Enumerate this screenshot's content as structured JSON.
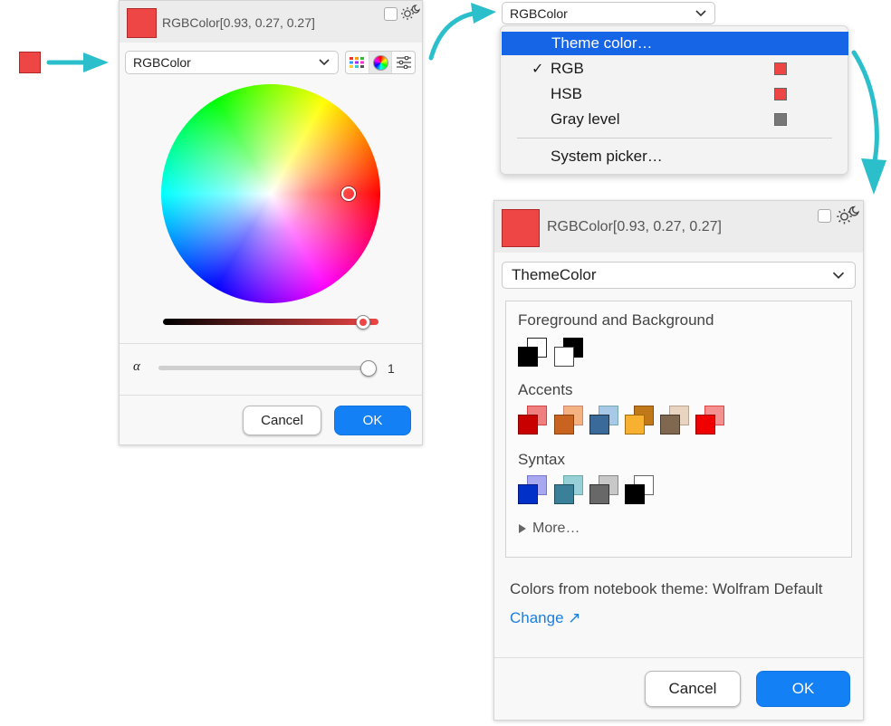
{
  "panel1": {
    "header_text": "RGBColor[0.93, 0.27, 0.27]",
    "dropdown_value": "RGBColor",
    "alpha_label": "α",
    "alpha_value": "1",
    "alpha_level": 1.0,
    "brightness_level": 0.93,
    "cancel_label": "Cancel",
    "ok_label": "OK"
  },
  "menu": {
    "trigger_value": "RGBColor",
    "items": [
      {
        "label": "Theme color…",
        "highlighted": true
      },
      {
        "label": "RGB",
        "checked": true,
        "swatch": "#ee4545"
      },
      {
        "label": "HSB",
        "swatch": "#ee4545"
      },
      {
        "label": "Gray level",
        "swatch": "#777777"
      },
      {
        "label": "System picker…"
      }
    ],
    "check_mark": "✓"
  },
  "panel2": {
    "header_text": "RGBColor[0.93, 0.27, 0.27]",
    "dropdown_value": "ThemeColor",
    "sections": [
      {
        "title": "Foreground and Background"
      },
      {
        "title": "Accents"
      },
      {
        "title": "Syntax"
      }
    ],
    "more_label": "More…",
    "theme_text": "Colors from notebook theme: Wolfram Default",
    "change_link": "Change ↗",
    "cancel_label": "Cancel",
    "ok_label": "OK"
  },
  "colors": {
    "accent_red": "#ee4545",
    "ok_blue": "#1380f5",
    "menu_highlight": "#1565e6",
    "link_blue": "#1a7fe0",
    "arrow_teal": "#2bbfcc"
  }
}
